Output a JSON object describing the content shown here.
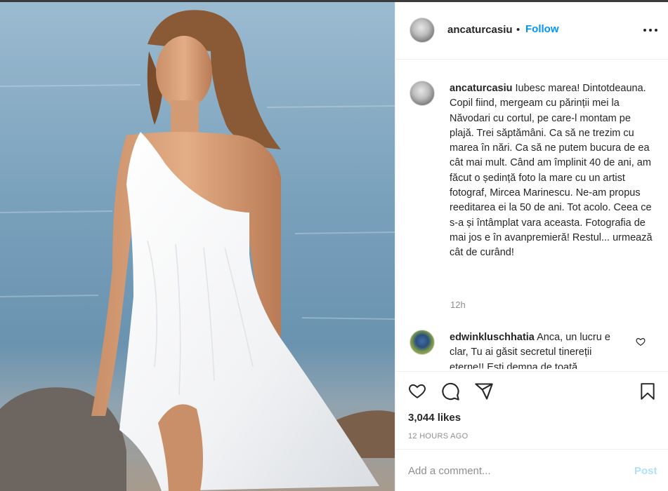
{
  "post": {
    "username": "ancaturcasiu",
    "separator": "•",
    "follow_label": "Follow",
    "more_icon": "more-horizontal-icon"
  },
  "caption": {
    "username": "ancaturcasiu",
    "text": "Iubesc marea! Dintotdeauna. Copil fiind, mergeam cu părinții mei la Năvodari cu cortul, pe care-l montam pe plajă. Trei săptămâni. Ca să ne trezim cu marea în nări. Ca să ne putem bucura de ea cât mai mult. Când am împlinit 40 de ani, am făcut o ședință foto la mare cu un artist fotograf, Mircea Marinescu. Ne-am propus reeditarea ei la 50 de ani. Tot acolo. Ceea ce s-a și întâmplat vara aceasta. Fotografia de mai jos e în avanpremieră! Restul... urmează cât de curând!",
    "time": "12h"
  },
  "comment": {
    "username": "edwinkluschhatia",
    "text": "Anca, un lucru e clar, Tu ai găsit secretul tinereții eterne!! Ești demna de toată"
  },
  "actions": {
    "like_icon": "heart-icon",
    "comment_icon": "comment-icon",
    "share_icon": "send-icon",
    "save_icon": "bookmark-icon",
    "likes": "3,044 likes",
    "posted": "12 HOURS AGO"
  },
  "add_comment": {
    "placeholder": "Add a comment...",
    "post_label": "Post"
  },
  "colors": {
    "accent": "#0095f6",
    "post_disabled": "#b2dffc",
    "muted": "#8e8e8e"
  }
}
